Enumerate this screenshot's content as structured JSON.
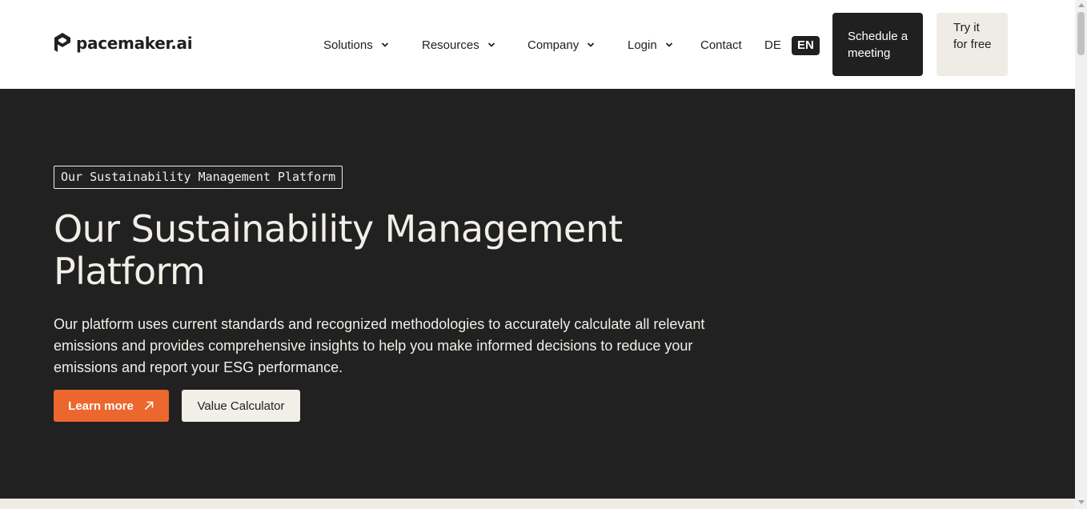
{
  "header": {
    "logo_text": "pacemaker.ai",
    "nav": [
      {
        "label": "Solutions",
        "dropdown": true
      },
      {
        "label": "Resources",
        "dropdown": true
      },
      {
        "label": "Company",
        "dropdown": true
      },
      {
        "label": "Login",
        "dropdown": true
      },
      {
        "label": "Contact",
        "dropdown": false
      }
    ],
    "languages": {
      "de": "DE",
      "en": "EN",
      "active": "EN"
    },
    "schedule_label": "Schedule a meeting",
    "try_label": "Try it for free"
  },
  "hero": {
    "tag": "Our Sustainability Management Platform",
    "title": "Our Sustainability Management Platform",
    "description": "Our platform uses current standards and recognized methodologies to accurately calculate all relevant emissions and provides comprehensive insights to help you make informed decisions to reduce your emissions and report your ESG performance.",
    "learn_more_label": "Learn more",
    "calculator_label": "Value Calculator"
  },
  "colors": {
    "hero_background": "#212121",
    "accent": "#ec672e",
    "light": "#f2efe9",
    "dark": "#202020"
  },
  "icons": {
    "logo": "pacemaker-logo-icon",
    "dropdown": "chevron-down-icon",
    "learn_more": "arrow-up-right-icon"
  }
}
